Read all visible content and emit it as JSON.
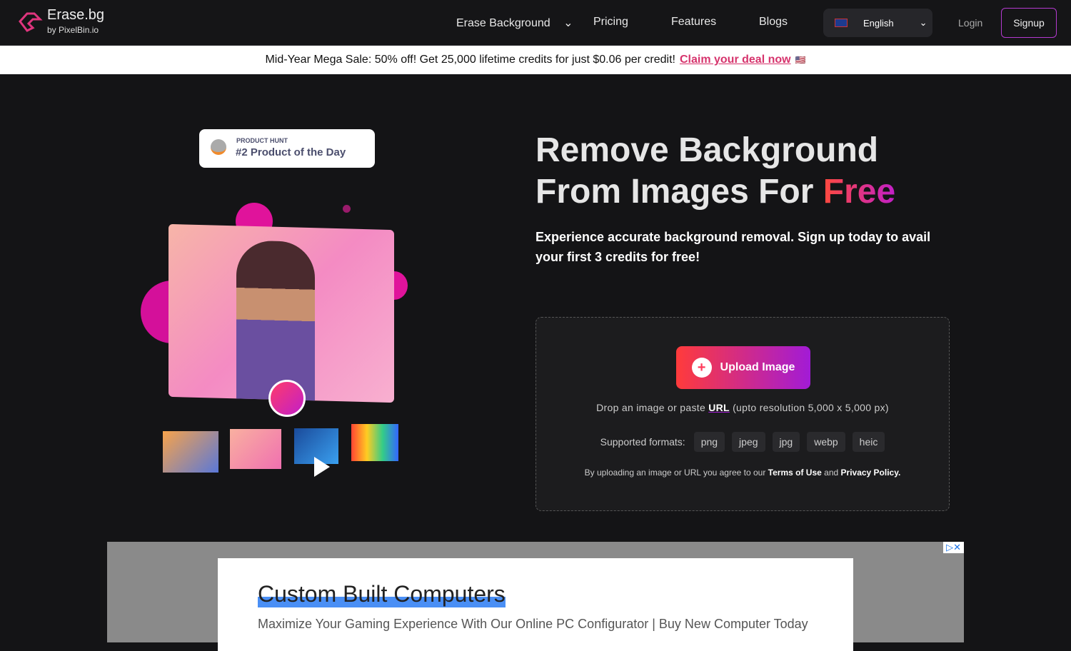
{
  "nav": {
    "logo_title": "Erase.bg",
    "logo_sub": "by PixelBin.io",
    "items": [
      "Erase Background",
      "Pricing",
      "Features",
      "Blogs"
    ],
    "language": "English",
    "login": "Login",
    "signup": "Signup"
  },
  "banner": {
    "text": "Mid-Year Mega Sale: 50% off! Get 25,000 lifetime credits for just $0.06 per credit!",
    "link": "Claim your deal now",
    "emoji": "🇺🇸"
  },
  "badge": {
    "label": "PRODUCT HUNT",
    "title": "#2 Product of the Day"
  },
  "hero": {
    "title_1": "Remove Background",
    "title_2": "From Images For ",
    "title_accent": "Free",
    "subtitle": "Experience accurate background removal. Sign up today to avail your first 3 credits for free!"
  },
  "upload": {
    "button": "Upload Image",
    "hint_pre": "Drop an image or paste ",
    "hint_link": "URL",
    "hint_post": " (upto resolution 5,000 x 5,000 px)",
    "formats_label": "Supported formats:",
    "formats": [
      "png",
      "jpeg",
      "jpg",
      "webp",
      "heic"
    ],
    "terms_pre": "By uploading an image or URL you agree to our ",
    "terms": "Terms of Use",
    "and": " and ",
    "privacy": "Privacy Policy."
  },
  "ad": {
    "title": "Custom Built Computers",
    "desc": "Maximize Your Gaming Experience With Our Online PC Configurator | Buy New Computer Today",
    "close": "▷✕"
  }
}
